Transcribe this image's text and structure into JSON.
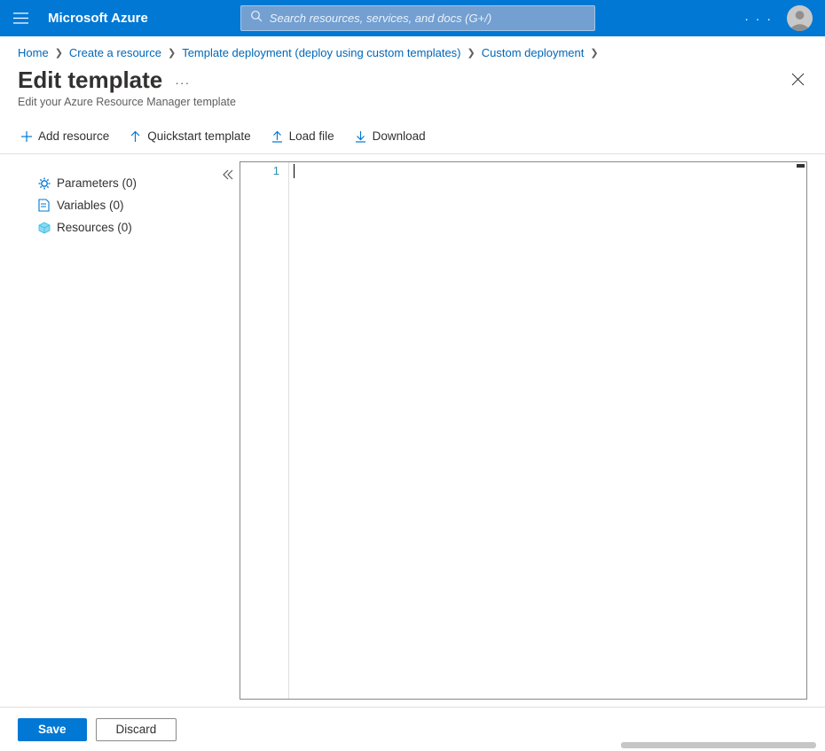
{
  "topbar": {
    "brand": "Microsoft Azure",
    "search_placeholder": "Search resources, services, and docs (G+/)"
  },
  "breadcrumb": {
    "items": [
      {
        "label": "Home"
      },
      {
        "label": "Create a resource"
      },
      {
        "label": "Template deployment (deploy using custom templates)"
      },
      {
        "label": "Custom deployment"
      }
    ]
  },
  "page": {
    "title": "Edit template",
    "subtitle": "Edit your Azure Resource Manager template"
  },
  "toolbar": {
    "add_resource": "Add resource",
    "quickstart": "Quickstart template",
    "load_file": "Load file",
    "download": "Download"
  },
  "tree": {
    "items": [
      {
        "label": "Parameters (0)",
        "icon": "gear",
        "color": "#0078d4"
      },
      {
        "label": "Variables (0)",
        "icon": "doc",
        "color": "#0078d4"
      },
      {
        "label": "Resources (0)",
        "icon": "cube",
        "color": "#32bde6"
      }
    ]
  },
  "editor": {
    "line_number": "1"
  },
  "footer": {
    "save": "Save",
    "discard": "Discard"
  }
}
